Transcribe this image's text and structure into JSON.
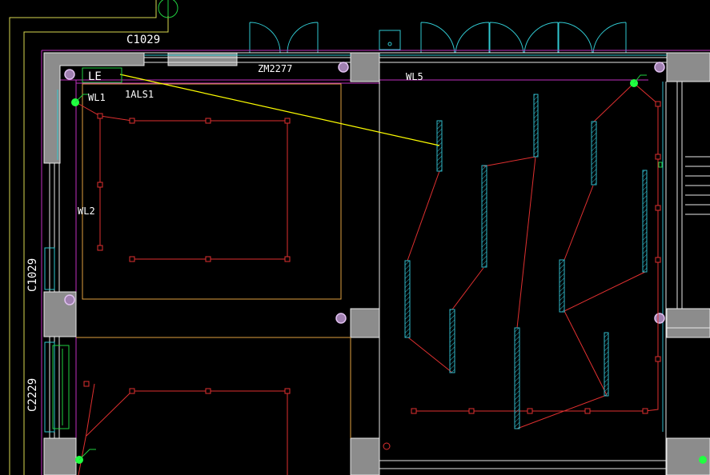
{
  "drawing": {
    "background": "#000000",
    "colors": {
      "wall_fill": "#8c8c8c",
      "wall_outline": "#e8e8e8",
      "room_outline": "#e0a040",
      "outer_line": "#d8d850",
      "boundary": "#c030c0",
      "wiring": "#e03030",
      "fixture": "#30b8c8",
      "leader": "#ffff00",
      "junction": "#20ff40",
      "door": "#30c8d0",
      "column": "#b070c0"
    },
    "labels": {
      "window_top": "C1029",
      "door_top": "ZM2277",
      "window_left_1": "C1029",
      "window_left_2": "C2229",
      "panel_tag": "LE",
      "panel_name": "1ALS1",
      "circuit_wl1": "WL1",
      "circuit_wl2": "WL2",
      "circuit_wl5": "WL5"
    }
  }
}
